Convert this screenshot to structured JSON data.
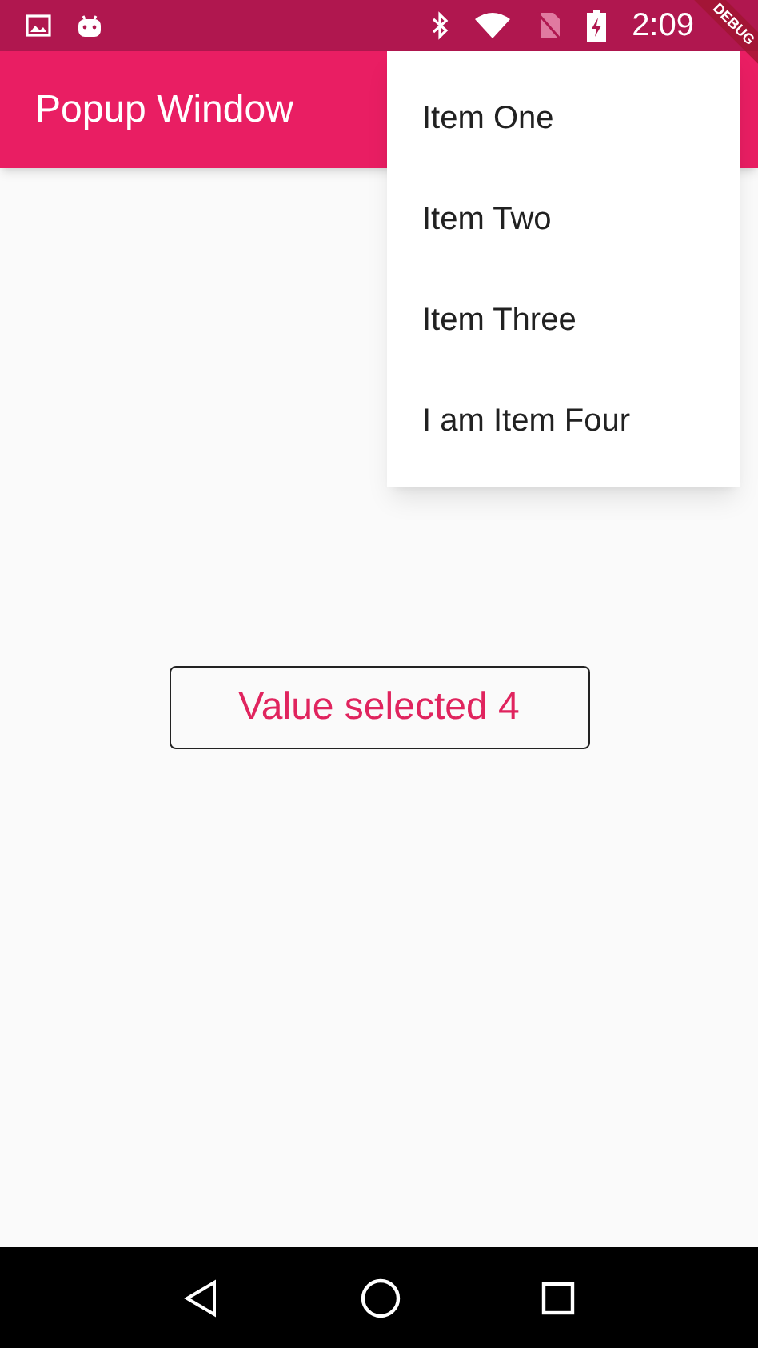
{
  "status_bar": {
    "time": "2:09"
  },
  "app_bar": {
    "title": "Popup Window"
  },
  "popup_menu": {
    "items": [
      {
        "label": "Item One"
      },
      {
        "label": "Item Two"
      },
      {
        "label": "Item Three"
      },
      {
        "label": "I am Item Four"
      }
    ]
  },
  "value_button": {
    "label": "Value selected 4"
  },
  "debug_banner": {
    "label": "DEBUG"
  }
}
